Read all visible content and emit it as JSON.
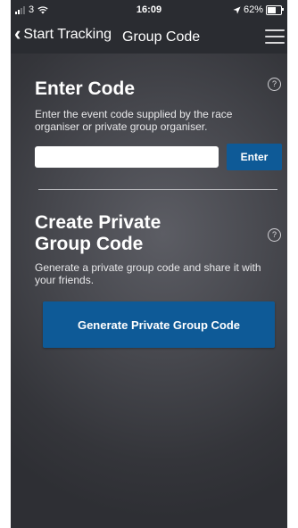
{
  "status_bar": {
    "carrier": "3",
    "time": "16:09",
    "battery": "62%",
    "battery_level": 0.62
  },
  "nav": {
    "back_label": "Start Tracking",
    "title": "Group Code"
  },
  "enter_code": {
    "title": "Enter Code",
    "description": "Enter the event code supplied by the race organiser or private group organiser.",
    "input_value": "",
    "button_label": "Enter"
  },
  "private_group": {
    "title": "Create Private Group Code",
    "description": "Generate a private group code and share it with your friends.",
    "button_label": "Generate Private Group Code"
  },
  "help_icon_glyph": "?",
  "colors": {
    "primary_button": "#0e5a97",
    "header": "#2a2c31",
    "background": "#46474d"
  }
}
